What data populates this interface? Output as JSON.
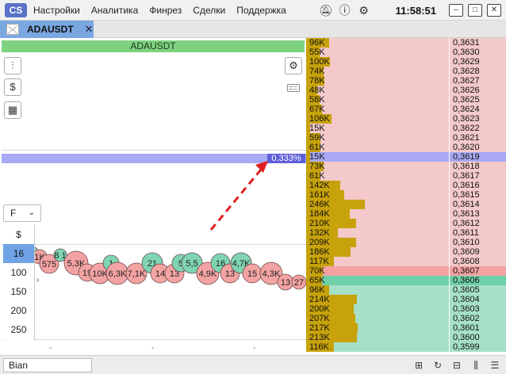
{
  "menu": {
    "items": [
      "Настройки",
      "Аналитика",
      "Финрез",
      "Сделки",
      "Поддержка"
    ],
    "clock": "11:58:51"
  },
  "tab": {
    "label": "ADAUSDT"
  },
  "chart": {
    "title": "ADAUSDT",
    "percent_label": "0.333%",
    "volume_select": "F",
    "volume_filters": [
      "$",
      "16",
      "100",
      "150",
      "200",
      "250"
    ],
    "selected_filter_index": 1,
    "x_ticks": [
      "-",
      "-",
      "-"
    ],
    "bubbles": [
      {
        "label": "",
        "color": "#f4a3a3",
        "side": "sell"
      },
      {
        "label": "8",
        "color": "#7fd4b2",
        "side": "buy"
      },
      {
        "label": "1K",
        "color": "#f4a3a3",
        "side": "sell"
      },
      {
        "label": "575",
        "color": "#f4a3a3",
        "side": "sell"
      },
      {
        "label": "8 1",
        "color": "#7fd4b2",
        "side": "buy"
      },
      {
        "label": "5,3K",
        "color": "#f4a3a3",
        "side": "sell"
      },
      {
        "label": "19",
        "color": "#f4a3a3",
        "side": "sell"
      },
      {
        "label": "10K",
        "color": "#f4a3a3",
        "side": "sell"
      },
      {
        "label": "1",
        "color": "#7fd4b2",
        "side": "buy"
      },
      {
        "label": "6,3K",
        "color": "#f4a3a3",
        "side": "sell"
      },
      {
        "label": "7,1K",
        "color": "#f4a3a3",
        "side": "sell"
      },
      {
        "label": "21",
        "color": "#7fd4b2",
        "side": "buy"
      },
      {
        "label": "14",
        "color": "#f4a3a3",
        "side": "sell"
      },
      {
        "label": "13",
        "color": "#f4a3a3",
        "side": "sell"
      },
      {
        "label": "5",
        "color": "#7fd4b2",
        "side": "buy"
      },
      {
        "label": "5,5",
        "color": "#7fd4b2",
        "side": "buy"
      },
      {
        "label": "4,9K",
        "color": "#f4a3a3",
        "side": "sell"
      },
      {
        "label": "16",
        "color": "#7fd4b2",
        "side": "buy"
      },
      {
        "label": "13",
        "color": "#f4a3a3",
        "side": "sell"
      },
      {
        "label": "4,7K",
        "color": "#7fd4b2",
        "side": "buy"
      },
      {
        "label": "15",
        "color": "#f4a3a3",
        "side": "sell"
      },
      {
        "label": "4,3K",
        "color": "#f4a3a3",
        "side": "sell"
      },
      {
        "label": "13",
        "color": "#f4a3a3",
        "side": "sell"
      },
      {
        "label": "27",
        "color": "#f4a3a3",
        "side": "sell"
      }
    ]
  },
  "order_book": {
    "colors": {
      "ask_bg": "#f3c9c9",
      "bid_bg": "#a6e0c8",
      "highlight_bg": "#a8a8f4",
      "best_ask_bg": "#f4a3a3",
      "best_bid_bg": "#6fcfa6",
      "volume_bar": "#c7a20a"
    },
    "rows": [
      {
        "vol": "96K",
        "price": "0,3631",
        "side": "ask",
        "level": 96
      },
      {
        "vol": "55K",
        "price": "0,3630",
        "side": "ask",
        "level": 55
      },
      {
        "vol": "100K",
        "price": "0,3629",
        "side": "ask",
        "level": 100
      },
      {
        "vol": "74K",
        "price": "0,3628",
        "side": "ask",
        "level": 74
      },
      {
        "vol": "78K",
        "price": "0,3627",
        "side": "ask",
        "level": 78
      },
      {
        "vol": "48K",
        "price": "0,3626",
        "side": "ask",
        "level": 48
      },
      {
        "vol": "58K",
        "price": "0,3625",
        "side": "ask",
        "level": 58
      },
      {
        "vol": "67K",
        "price": "0,3624",
        "side": "ask",
        "level": 67
      },
      {
        "vol": "106K",
        "price": "0,3623",
        "side": "ask",
        "level": 106
      },
      {
        "vol": "15K",
        "price": "0,3622",
        "side": "ask",
        "level": 15
      },
      {
        "vol": "59K",
        "price": "0,3621",
        "side": "ask",
        "level": 59
      },
      {
        "vol": "61K",
        "price": "0,3620",
        "side": "ask",
        "level": 61
      },
      {
        "vol": "15K",
        "price": "0,3619",
        "side": "highlight",
        "level": 15
      },
      {
        "vol": "73K",
        "price": "0,3618",
        "side": "ask",
        "level": 73
      },
      {
        "vol": "61K",
        "price": "0,3617",
        "side": "ask",
        "level": 61
      },
      {
        "vol": "142K",
        "price": "0,3616",
        "side": "ask",
        "level": 142
      },
      {
        "vol": "161K",
        "price": "0,3615",
        "side": "ask",
        "level": 161
      },
      {
        "vol": "246K",
        "price": "0,3614",
        "side": "ask",
        "level": 246
      },
      {
        "vol": "184K",
        "price": "0,3613",
        "side": "ask",
        "level": 184
      },
      {
        "vol": "210K",
        "price": "0,3612",
        "side": "ask",
        "level": 210
      },
      {
        "vol": "132K",
        "price": "0,3611",
        "side": "ask",
        "level": 132
      },
      {
        "vol": "209K",
        "price": "0,3610",
        "side": "ask",
        "level": 209
      },
      {
        "vol": "186K",
        "price": "0,3609",
        "side": "ask",
        "level": 186
      },
      {
        "vol": "117K",
        "price": "0,3608",
        "side": "ask",
        "level": 117
      },
      {
        "vol": "70K",
        "price": "0,3607",
        "side": "best_ask",
        "level": 70
      },
      {
        "vol": "65K",
        "price": "0,3606",
        "side": "best_bid",
        "level": 65
      },
      {
        "vol": "96K",
        "price": "0,3605",
        "side": "bid",
        "level": 96
      },
      {
        "vol": "214K",
        "price": "0,3604",
        "side": "bid",
        "level": 214
      },
      {
        "vol": "200K",
        "price": "0,3603",
        "side": "bid",
        "level": 200
      },
      {
        "vol": "207K",
        "price": "0,3602",
        "side": "bid",
        "level": 207
      },
      {
        "vol": "217K",
        "price": "0,3601",
        "side": "bid",
        "level": 217
      },
      {
        "vol": "213K",
        "price": "0,3600",
        "side": "bid",
        "level": 213
      },
      {
        "vol": "116K",
        "price": "0,3599",
        "side": "bid",
        "level": 116
      }
    ]
  },
  "status": {
    "exchange": "Bian"
  },
  "icons": {
    "logo": "app-logo-icon",
    "mute": "bell-off-icon",
    "help": "help-icon",
    "settings": "gear-icon"
  }
}
